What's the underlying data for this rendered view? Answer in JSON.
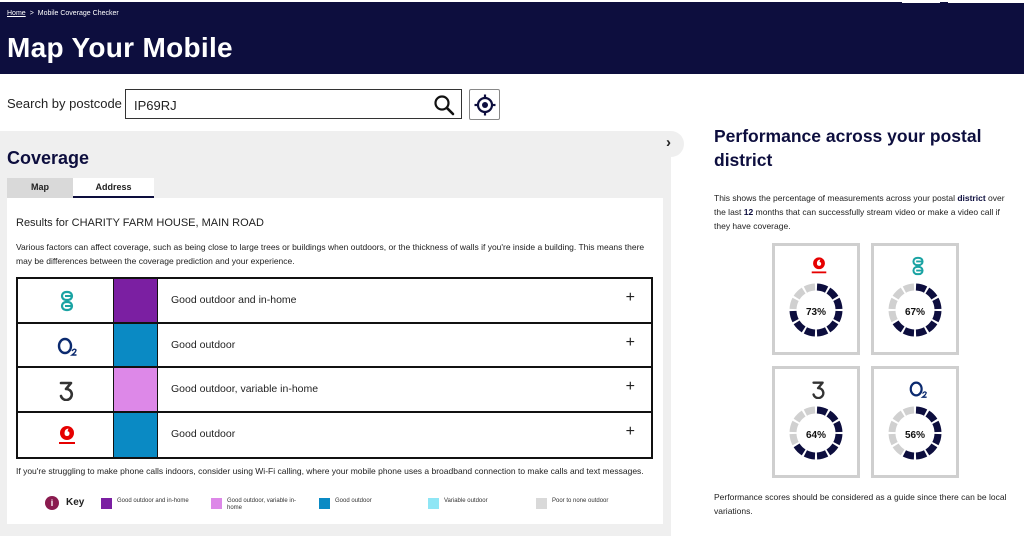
{
  "header": {
    "breadcrumb_home": "Home",
    "breadcrumb_sep": ">",
    "breadcrumb_current": "Mobile Coverage Checker",
    "title": "Map Your Mobile"
  },
  "search": {
    "label": "Search by postcode",
    "value": "IP69RJ",
    "search_icon": "search-icon",
    "locate_icon": "crosshair-icon"
  },
  "coverage": {
    "title": "Coverage",
    "tabs": [
      {
        "label": "Map",
        "active": false
      },
      {
        "label": "Address",
        "active": true
      }
    ],
    "results_for": "Results for CHARITY FARM HOUSE, MAIN ROAD",
    "factors_note": "Various factors can affect coverage, such as being close to large trees or buildings when outdoors, or the thickness of walls if you're inside a building. This means there may be differences between the coverage prediction and your experience.",
    "operators": [
      {
        "name": "EE",
        "icon": "ee-logo-icon",
        "color": "#7b1fa2",
        "status": "Good outdoor and in-home",
        "expand": "+"
      },
      {
        "name": "O2",
        "icon": "o2-logo-icon",
        "color": "#0a8ac4",
        "status": "Good outdoor",
        "expand": "+"
      },
      {
        "name": "Three",
        "icon": "three-logo-icon",
        "color": "#dd88e8",
        "status": "Good outdoor, variable in-home",
        "expand": "+"
      },
      {
        "name": "Vodafone",
        "icon": "vodafone-logo-icon",
        "color": "#0a8ac4",
        "status": "Good outdoor",
        "expand": "+"
      }
    ],
    "wifi_note": "If you're struggling to make phone calls indoors, consider using Wi-Fi calling, where your mobile phone uses a broadband connection to make calls and text messages.",
    "key": {
      "title": "Key",
      "info_icon": "info-icon",
      "info_glyph": "i",
      "items": [
        {
          "label": "Good outdoor and in-home",
          "color": "#7b1fa2"
        },
        {
          "label": "Good outdoor, variable in-home",
          "color": "#dd88e8"
        },
        {
          "label": "Good outdoor",
          "color": "#0a8ac4"
        },
        {
          "label": "Variable outdoor",
          "color": "#8fe6f5"
        },
        {
          "label": "Poor to none outdoor",
          "color": "#d9d9d9"
        }
      ]
    }
  },
  "performance": {
    "title": "Performance across your postal district",
    "desc_pre": "This shows the percentage of measurements across your postal ",
    "desc_bold1": "district",
    "desc_mid": " over the last ",
    "desc_bold2": "12",
    "desc_post": " months that can successfully stream video or make a video call if they have coverage.",
    "gauges": [
      {
        "operator": "Vodafone",
        "icon": "vodafone-logo-icon",
        "percent": 73,
        "label": "73%"
      },
      {
        "operator": "EE",
        "icon": "ee-logo-icon",
        "percent": 67,
        "label": "67%"
      },
      {
        "operator": "Three",
        "icon": "three-logo-icon",
        "percent": 64,
        "label": "64%"
      },
      {
        "operator": "O2",
        "icon": "o2-logo-icon",
        "percent": 56,
        "label": "56%"
      }
    ],
    "footnote": "Performance scores should be considered as a guide since there can be local variations."
  },
  "colors": {
    "header_bg": "#0d0e3e",
    "gauge_fill": "#0d0e3e",
    "gauge_track": "#d0d0d0"
  },
  "collapse_glyph": "›"
}
